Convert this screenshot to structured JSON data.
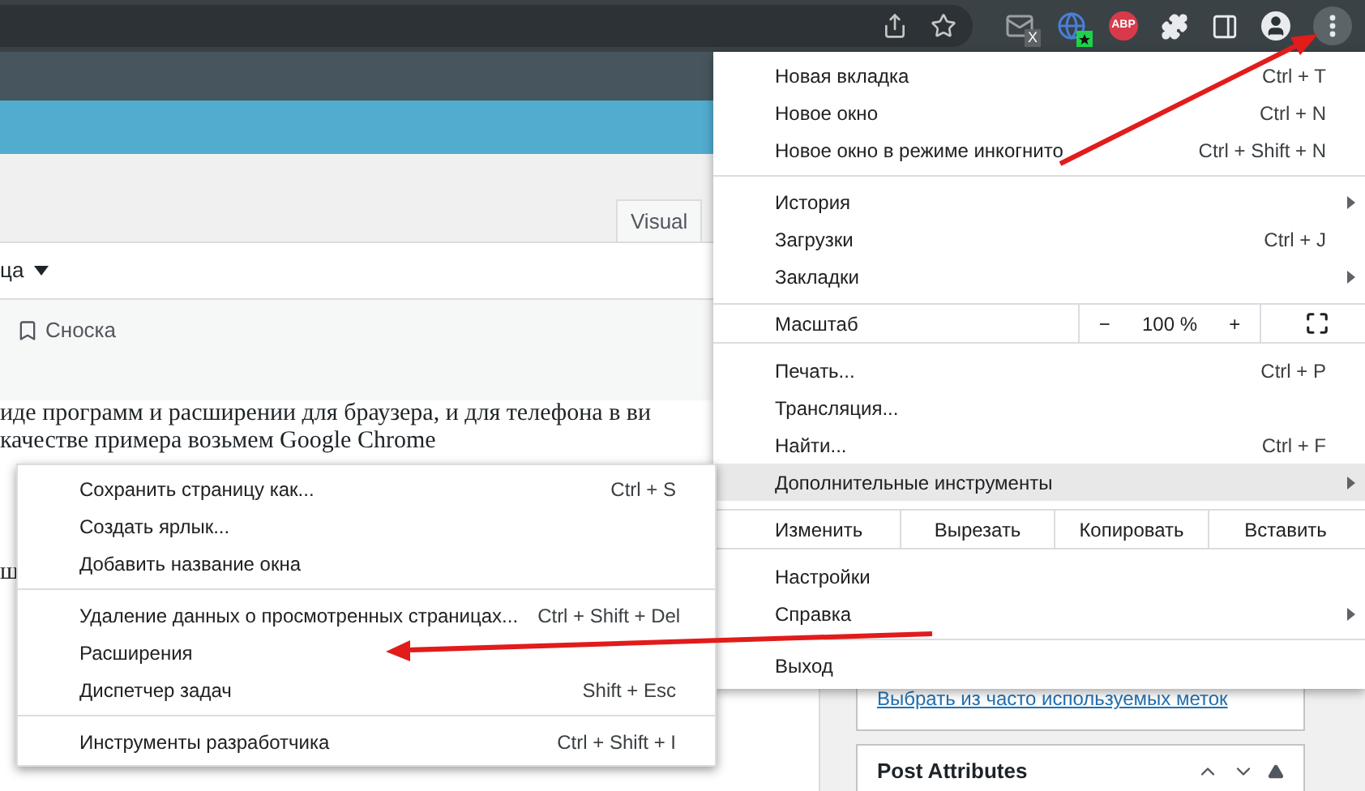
{
  "toolbar": {
    "mail_badge": "X",
    "abp": "ABP"
  },
  "editor": {
    "tab": {
      "label": "Visual"
    },
    "format_dropdown": {
      "label": "ца"
    },
    "footnote_button": {
      "label": "Сноска"
    },
    "paragraph": [
      "иде программ и расширении для браузера, и для телефона в ви",
      "качестве примера возьмем Google Chrome"
    ],
    "fragment": "ш"
  },
  "sidebar": {
    "tags_link": "Выбрать из часто используемых меток",
    "post_attributes": {
      "title": "Post Attributes"
    }
  },
  "menu": {
    "items": [
      {
        "kind": "item",
        "label": "Новая вкладка",
        "shortcut": "Ctrl + T",
        "submenu": false,
        "selected": false
      },
      {
        "kind": "item",
        "label": "Новое окно",
        "shortcut": "Ctrl + N",
        "submenu": false,
        "selected": false
      },
      {
        "kind": "item",
        "label": "Новое окно в режиме инкогнито",
        "shortcut": "Ctrl + Shift + N",
        "submenu": false,
        "selected": false
      },
      {
        "kind": "separator"
      },
      {
        "kind": "item",
        "label": "История",
        "submenu": true,
        "selected": false
      },
      {
        "kind": "item",
        "label": "Загрузки",
        "shortcut": "Ctrl + J",
        "submenu": false,
        "selected": false
      },
      {
        "kind": "item",
        "label": "Закладки",
        "submenu": true,
        "selected": false
      },
      {
        "kind": "zoom",
        "label": "Масштаб",
        "minus": "−",
        "value": "100 %",
        "plus": "+"
      },
      {
        "kind": "item",
        "label": "Печать...",
        "shortcut": "Ctrl + P",
        "submenu": false,
        "selected": false
      },
      {
        "kind": "item",
        "label": "Трансляция...",
        "submenu": false,
        "selected": false
      },
      {
        "kind": "item",
        "label": "Найти...",
        "shortcut": "Ctrl + F",
        "submenu": false,
        "selected": false
      },
      {
        "kind": "item",
        "label": "Дополнительные инструменты",
        "submenu": true,
        "selected": true
      },
      {
        "kind": "edit",
        "label": "Изменить",
        "buttons": [
          "Вырезать",
          "Копировать",
          "Вставить"
        ]
      },
      {
        "kind": "item",
        "label": "Настройки",
        "submenu": false,
        "selected": false
      },
      {
        "kind": "item",
        "label": "Справка",
        "submenu": true,
        "selected": false
      },
      {
        "kind": "separator"
      },
      {
        "kind": "item",
        "label": "Выход",
        "submenu": false,
        "selected": false
      }
    ]
  },
  "submenu": {
    "items": [
      {
        "kind": "item",
        "label": "Сохранить страницу как...",
        "shortcut": "Ctrl + S"
      },
      {
        "kind": "item",
        "label": "Создать ярлык..."
      },
      {
        "kind": "item",
        "label": "Добавить название окна"
      },
      {
        "kind": "separator"
      },
      {
        "kind": "item",
        "label": "Удаление данных о просмотренных страницах...",
        "shortcut": "Ctrl + Shift + Del"
      },
      {
        "kind": "item",
        "label": "Расширения"
      },
      {
        "kind": "item",
        "label": "Диспетчер задач",
        "shortcut": "Shift + Esc"
      },
      {
        "kind": "separator"
      },
      {
        "kind": "item",
        "label": "Инструменты разработчика",
        "shortcut": "Ctrl + Shift + I"
      }
    ]
  }
}
